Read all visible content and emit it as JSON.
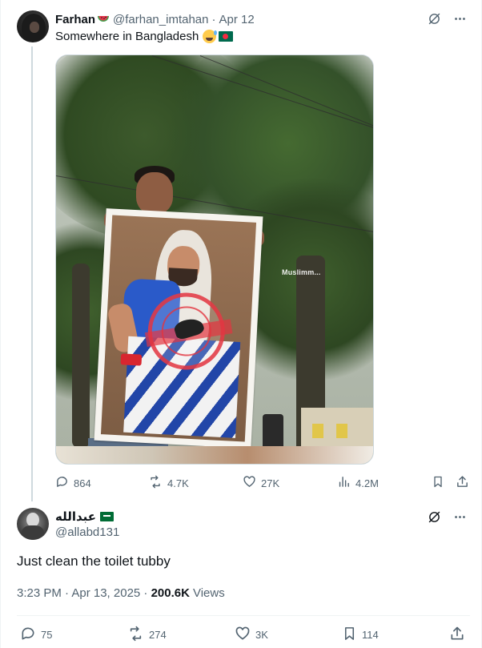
{
  "original_tweet": {
    "display_name": "Farhan",
    "name_emoji": "watermelon",
    "handle": "@farhan_imtahan",
    "separator": "·",
    "date": "Apr 12",
    "text": "Somewhere in Bangladesh",
    "text_emojis": [
      "sweat-smile",
      "flag-bangladesh"
    ],
    "image_watermark": "Muslimm...",
    "stats": {
      "replies": "864",
      "retweets": "4.7K",
      "likes": "27K",
      "views": "4.2M"
    }
  },
  "reply_tweet": {
    "display_name": "عبدالله",
    "name_emoji": "flag-saudi-arabia",
    "handle": "@allabd131",
    "text": "Just clean the toilet tubby",
    "timestamp": "3:23 PM · Apr 13, 2025 · ",
    "view_count": "200.6K",
    "views_label": "Views",
    "stats": {
      "replies": "75",
      "retweets": "274",
      "likes": "3K",
      "bookmarks": "114"
    }
  },
  "colors": {
    "text_primary": "#0f1419",
    "text_secondary": "#536471",
    "border": "#cfd9de",
    "divider": "#eff3f4",
    "background": "#ffffff"
  },
  "icons": [
    "grok-icon",
    "more-icon",
    "reply-icon",
    "retweet-icon",
    "like-icon",
    "views-icon",
    "bookmark-icon",
    "share-icon"
  ]
}
